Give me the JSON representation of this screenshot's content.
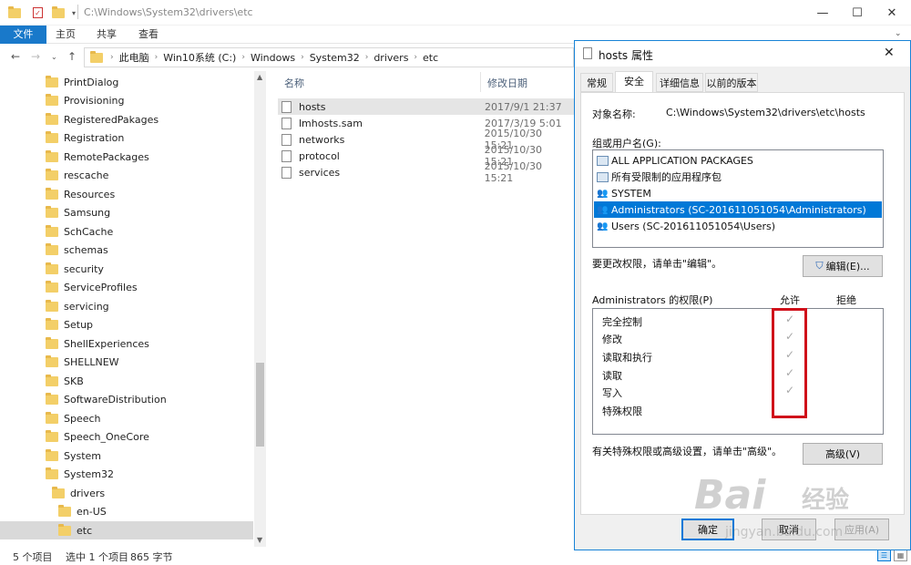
{
  "explorer": {
    "title_path": "C:\\Windows\\System32\\drivers\\etc",
    "ribbon_tabs": [
      "文件",
      "主页",
      "共享",
      "查看"
    ],
    "breadcrumb": [
      "此电脑",
      "Win10系统 (C:)",
      "Windows",
      "System32",
      "drivers",
      "etc"
    ],
    "tree_items": [
      "PrintDialog",
      "Provisioning",
      "RegisteredPakages",
      "Registration",
      "RemotePackages",
      "rescache",
      "Resources",
      "Samsung",
      "SchCache",
      "schemas",
      "security",
      "ServiceProfiles",
      "servicing",
      "Setup",
      "ShellExperiences",
      "SHELLNEW",
      "SKB",
      "SoftwareDistribution",
      "Speech",
      "Speech_OneCore",
      "System",
      "System32",
      "drivers",
      "en-US",
      "etc"
    ],
    "columns": {
      "name": "名称",
      "date": "修改日期"
    },
    "files": [
      {
        "name": "hosts",
        "date": "2017/9/1 21:37"
      },
      {
        "name": "lmhosts.sam",
        "date": "2017/3/19 5:01"
      },
      {
        "name": "networks",
        "date": "2015/10/30 15:21"
      },
      {
        "name": "protocol",
        "date": "2015/10/30 15:21"
      },
      {
        "name": "services",
        "date": "2015/10/30 15:21"
      }
    ],
    "status_count": "5 个项目",
    "status_selected": "选中 1 个项目",
    "status_size": "865 字节"
  },
  "dialog": {
    "title": "hosts 属性",
    "tabs": [
      "常规",
      "安全",
      "详细信息",
      "以前的版本"
    ],
    "object_label": "对象名称:",
    "object_value": "C:\\Windows\\System32\\drivers\\etc\\hosts",
    "group_label": "组或用户名(G):",
    "users": [
      "ALL APPLICATION PACKAGES",
      "所有受限制的应用程序包",
      "SYSTEM",
      "Administrators (SC-201611051054\\Administrators)",
      "Users (SC-201611051054\\Users)"
    ],
    "change_hint": "要更改权限，请单击\"编辑\"。",
    "edit_button": "编辑(E)...",
    "perm_label": "Administrators 的权限(P)",
    "allow": "允许",
    "deny": "拒绝",
    "permissions": [
      "完全控制",
      "修改",
      "读取和执行",
      "读取",
      "写入",
      "特殊权限"
    ],
    "advanced_hint": "有关特殊权限或高级设置，请单击\"高级\"。",
    "advanced_button": "高级(V)",
    "ok": "确定",
    "cancel": "取消",
    "apply": "应用(A)"
  },
  "watermark": {
    "brand": "Bai",
    "brand2": "经验",
    "url": "jingyan.baidu.com"
  },
  "colors": {
    "accent": "#0078d7",
    "highlight_box": "#d0101a",
    "folder": "#f3cf68"
  }
}
